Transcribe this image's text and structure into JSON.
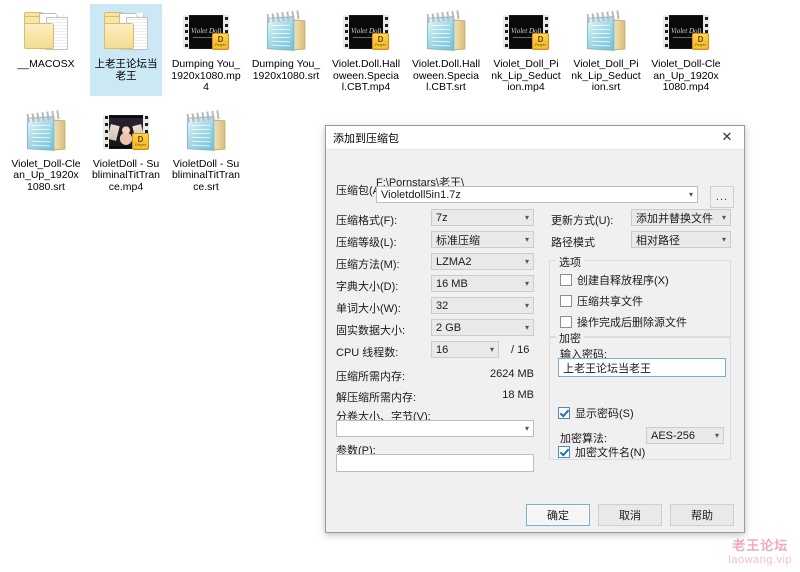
{
  "desktop": {
    "files": [
      {
        "name": "__MACOSX",
        "type": "folder",
        "selected": false
      },
      {
        "name": "上老王论坛当老王",
        "type": "folder",
        "selected": true
      },
      {
        "name": "Dumping You_1920x1080.mp4",
        "type": "video",
        "thumb_text": "Violet Doll",
        "badge": "D",
        "badge_sub": "Player",
        "selected": false
      },
      {
        "name": "Dumping You_1920x1080.srt",
        "type": "subtitle",
        "selected": false
      },
      {
        "name": "Violet.Doll.Halloween.Special.CBT.mp4",
        "type": "video",
        "thumb_text": "Violet Doll",
        "badge": "D",
        "badge_sub": "Player",
        "selected": false
      },
      {
        "name": "Violet.Doll.Halloween.Special.CBT.srt",
        "type": "subtitle",
        "selected": false
      },
      {
        "name": "Violet_Doll_Pink_Lip_Seduction.mp4",
        "type": "video",
        "thumb_text": "Violet Doll",
        "badge": "D",
        "badge_sub": "Player",
        "selected": false
      },
      {
        "name": "Violet_Doll_Pink_Lip_Seduction.srt",
        "type": "subtitle",
        "selected": false
      },
      {
        "name": "Violet_Doll-Clean_Up_1920x1080.mp4",
        "type": "video",
        "thumb_text": "Violet Doll",
        "badge": "D",
        "badge_sub": "Player",
        "selected": false
      },
      {
        "name": "Violet_Doll-Clean_Up_1920x1080.srt",
        "type": "subtitle",
        "selected": false
      },
      {
        "name": "VioletDoll - SubliminalTitTrance.mp4",
        "type": "video-photo",
        "badge": "D",
        "badge_sub": "Player",
        "selected": false
      },
      {
        "name": "VioletDoll - SubliminalTitTrance.srt",
        "type": "subtitle",
        "selected": false
      }
    ]
  },
  "watermark": {
    "cn": "老王论坛",
    "en": "laowang.vip",
    "color": "#f0a8bd"
  },
  "dialog": {
    "title": "添加到压缩包",
    "close_glyph": "✕",
    "archive": {
      "label": "压缩包(A):",
      "path": "F:\\Pornstars\\老王\\",
      "value": "Violetdoll5in1.7z",
      "browse_label": "..."
    },
    "left_fields": [
      {
        "label": "压缩格式(F):",
        "value": "7z"
      },
      {
        "label": "压缩等级(L):",
        "value": "标准压缩"
      },
      {
        "label": "压缩方法(M):",
        "value": "LZMA2"
      },
      {
        "label": "字典大小(D):",
        "value": "16 MB"
      },
      {
        "label": "单词大小(W):",
        "value": "32"
      },
      {
        "label": "固实数据大小:",
        "value": "2 GB"
      }
    ],
    "cpu": {
      "label": "CPU 线程数:",
      "value": "16",
      "max": "/ 16"
    },
    "memory": [
      {
        "label": "压缩所需内存:",
        "value": "2624 MB"
      },
      {
        "label": "解压缩所需内存:",
        "value": "18 MB"
      }
    ],
    "volume": {
      "label": "分卷大小、字节(V):",
      "value": ""
    },
    "parameters": {
      "label": "参数(P):",
      "value": ""
    },
    "right_fields": [
      {
        "label": "更新方式(U):",
        "value": "添加并替换文件"
      },
      {
        "label": "路径模式",
        "value": "相对路径"
      }
    ],
    "options": {
      "title": "选项",
      "items": [
        {
          "label": "创建自释放程序(X)",
          "checked": false
        },
        {
          "label": "压缩共享文件",
          "checked": false
        },
        {
          "label": "操作完成后删除源文件",
          "checked": false
        }
      ]
    },
    "encryption": {
      "title": "加密",
      "password_label": "输入密码:",
      "password_value": "上老王论坛当老王",
      "show_password": {
        "label": "显示密码(S)",
        "checked": true
      },
      "algorithm_label": "加密算法:",
      "algorithm_value": "AES-256",
      "encrypt_names": {
        "label": "加密文件名(N)",
        "checked": true
      }
    },
    "buttons": {
      "ok": "确定",
      "cancel": "取消",
      "help": "帮助"
    }
  }
}
